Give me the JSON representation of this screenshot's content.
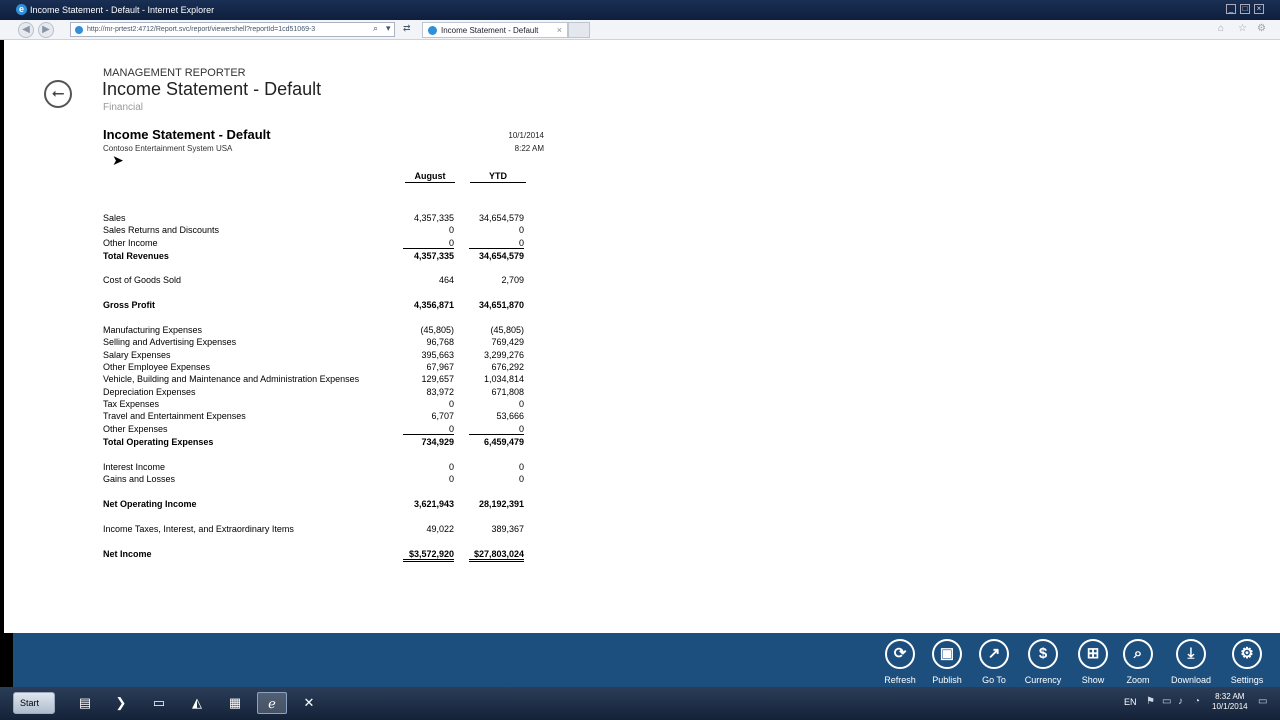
{
  "window": {
    "title": "Income Statement - Default - Internet Explorer",
    "controls": [
      "_",
      "□",
      "×"
    ]
  },
  "browser": {
    "address": "http://mr-prtest2:4712/Report.svc/report/viewershell?reportId=1cd51069-3",
    "tab_title": "Income Statement - Default",
    "tab_close": "×"
  },
  "page": {
    "app_label": "MANAGEMENT REPORTER",
    "title": "Income Statement - Default",
    "subtitle": "Financial",
    "back_glyph": "⭠"
  },
  "report": {
    "title": "Income Statement - Default",
    "company": "Contoso Entertainment System USA",
    "date": "10/1/2014",
    "time": "8:22 AM",
    "columns": [
      "August",
      "YTD"
    ],
    "rows": [
      {
        "label": "Sales",
        "v1": "4,357,335",
        "v2": "34,654,579"
      },
      {
        "label": "Sales Returns and Discounts",
        "v1": "0",
        "v2": "0"
      },
      {
        "label": "Other Income",
        "v1": "0",
        "v2": "0"
      },
      {
        "label": "Total Revenues",
        "v1": "4,357,335",
        "v2": "34,654,579"
      },
      {
        "label": "Cost of Goods Sold",
        "v1": "464",
        "v2": "2,709"
      },
      {
        "label": "Gross Profit",
        "v1": "4,356,871",
        "v2": "34,651,870"
      },
      {
        "label": "Manufacturing Expenses",
        "v1": "(45,805)",
        "v2": "(45,805)"
      },
      {
        "label": "Selling and Advertising Expenses",
        "v1": "96,768",
        "v2": "769,429"
      },
      {
        "label": "Salary Expenses",
        "v1": "395,663",
        "v2": "3,299,276"
      },
      {
        "label": "Other Employee Expenses",
        "v1": "67,967",
        "v2": "676,292"
      },
      {
        "label": "Vehicle, Building and Maintenance and Administration Expenses",
        "v1": "129,657",
        "v2": "1,034,814"
      },
      {
        "label": "Depreciation Expenses",
        "v1": "83,972",
        "v2": "671,808"
      },
      {
        "label": "Tax Expenses",
        "v1": "0",
        "v2": "0"
      },
      {
        "label": "Travel and Entertainment Expenses",
        "v1": "6,707",
        "v2": "53,666"
      },
      {
        "label": "Other Expenses",
        "v1": "0",
        "v2": "0"
      },
      {
        "label": "Total Operating Expenses",
        "v1": "734,929",
        "v2": "6,459,479"
      },
      {
        "label": "Interest Income",
        "v1": "0",
        "v2": "0"
      },
      {
        "label": "Gains and Losses",
        "v1": "0",
        "v2": "0"
      },
      {
        "label": "Net Operating Income",
        "v1": "3,621,943",
        "v2": "28,192,391"
      },
      {
        "label": "Income Taxes, Interest, and Extraordinary Items",
        "v1": "49,022",
        "v2": "389,367"
      },
      {
        "label": "Net Income",
        "v1": "$3,572,920",
        "v2": "$27,803,024"
      }
    ]
  },
  "commands": [
    {
      "label": "Refresh",
      "icon": "refresh-icon",
      "glyph": "⟳"
    },
    {
      "label": "Publish",
      "icon": "publish-icon",
      "glyph": "▣"
    },
    {
      "label": "Go To",
      "icon": "goto-icon",
      "glyph": "↗"
    },
    {
      "label": "Currency",
      "icon": "currency-icon",
      "glyph": "$"
    },
    {
      "label": "Show",
      "icon": "show-icon",
      "glyph": "⊞"
    },
    {
      "label": "Zoom",
      "icon": "zoom-icon",
      "glyph": "⌕"
    },
    {
      "label": "Download",
      "icon": "download-icon",
      "glyph": "⤓"
    },
    {
      "label": "Settings",
      "icon": "settings-icon",
      "glyph": "⚙"
    }
  ],
  "taskbar": {
    "start_label": "Start",
    "language": "EN",
    "time": "8:32 AM",
    "date": "10/1/2014"
  }
}
